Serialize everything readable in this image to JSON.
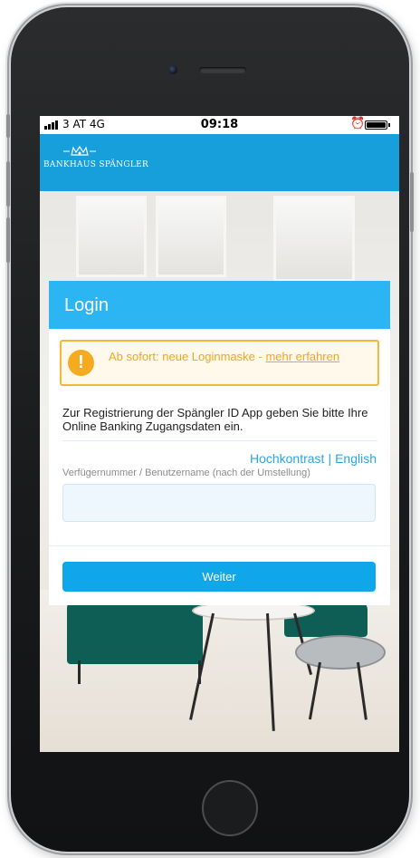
{
  "status_bar": {
    "carrier": "3 AT  4G",
    "time": "09:18",
    "alarm_icon": "alarm-clock-icon",
    "battery_level": 1.0
  },
  "brand": {
    "name": "BANKHAUS SPÄNGLER",
    "bar_color": "#169fdb"
  },
  "login": {
    "title": "Login",
    "header_color": "#2bb6f3",
    "notice": {
      "icon": "exclamation-icon",
      "text": "Ab sofort: neue Loginmaske - ",
      "link_text": "mehr erfahren",
      "color": "#f4ab1f"
    },
    "intro": "Zur Registrierung der Spängler ID App geben Sie bitte Ihre Online Banking Zugangsdaten ein.",
    "links": {
      "contrast": "Hochkontrast",
      "separator": "|",
      "language": "English"
    },
    "username": {
      "label": "Verfügernummer / Benutzername (nach der Umstellung)",
      "value": "",
      "placeholder": ""
    },
    "submit_label": "Weiter",
    "button_color": "#0fa6ea"
  }
}
